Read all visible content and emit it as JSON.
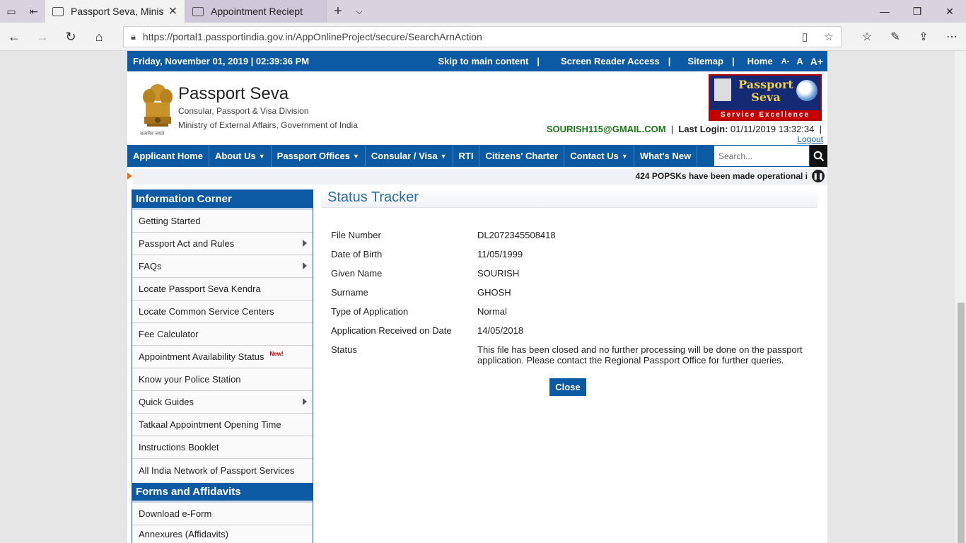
{
  "browser": {
    "tabs": [
      {
        "title": "Passport Seva, Ministry",
        "active": true
      },
      {
        "title": "Appointment Reciept",
        "active": false
      }
    ],
    "url": "https://portal1.passportindia.gov.in/AppOnlineProject/secure/SearchArnAction"
  },
  "topbar": {
    "datetime": "Friday,  November  01, 2019 | 02:39:36 PM",
    "skip": "Skip to main content",
    "screen_reader": "Screen Reader Access",
    "sitemap": "Sitemap",
    "home": "Home",
    "font_small": "A-",
    "font_normal": "A",
    "font_large": "A+",
    "sep": "|"
  },
  "header": {
    "title": "Passport Seva",
    "subtitle1": "Consular, Passport & Visa Division",
    "subtitle2": "Ministry of External Affairs, Government of India",
    "emblem_caption": "सत्यमेव जयते",
    "logo_line1": "Passport",
    "logo_line2": "Seva",
    "logo_band": "Service Excellence",
    "user_email": "SOURISH115@GMAIL.COM",
    "last_login_label": "Last Login:",
    "last_login_value": "01/11/2019 13:32:34",
    "logout": "Logout"
  },
  "nav": {
    "items": [
      {
        "label": "Applicant Home"
      },
      {
        "label": "About Us"
      },
      {
        "label": "Passport Offices"
      },
      {
        "label": "Consular / Visa"
      },
      {
        "label": "RTI"
      },
      {
        "label": "Citizens' Charter"
      },
      {
        "label": "Contact Us"
      },
      {
        "label": "What's New"
      }
    ],
    "search_placeholder": "Search..."
  },
  "ticker": {
    "text": "424 POPSKs have been made operational i"
  },
  "sidebar": {
    "section1_title": "Information Corner",
    "items": [
      {
        "label": "Getting Started"
      },
      {
        "label": "Passport Act and Rules"
      },
      {
        "label": "FAQs"
      },
      {
        "label": "Locate Passport Seva Kendra"
      },
      {
        "label": "Locate Common Service Centers"
      },
      {
        "label": "Fee Calculator"
      },
      {
        "label": "Appointment Availability Status"
      },
      {
        "label": "Know your Police Station"
      },
      {
        "label": "Quick Guides"
      },
      {
        "label": "Tatkaal Appointment Opening Time"
      },
      {
        "label": "Instructions Booklet"
      },
      {
        "label": "All India Network of Passport Services"
      }
    ],
    "new_badge": "New!",
    "section2_title": "Forms and Affidavits",
    "items2": [
      {
        "label": "Download e-Form"
      },
      {
        "label": "Annexures (Affidavits)"
      }
    ]
  },
  "status": {
    "title": "Status Tracker",
    "rows": [
      {
        "label": "File Number",
        "value": "DL2072345508418"
      },
      {
        "label": "Date of Birth",
        "value": "11/05/1999"
      },
      {
        "label": "Given Name",
        "value": "SOURISH"
      },
      {
        "label": "Surname",
        "value": "GHOSH"
      },
      {
        "label": "Type of Application",
        "value": "Normal"
      },
      {
        "label": "Application Received on Date",
        "value": "14/05/2018"
      },
      {
        "label": "Status",
        "value": "This file has been closed and no further processing will be done on the passport application. Please contact the Regional Passport Office for further queries."
      }
    ],
    "close_label": "Close"
  },
  "colors": {
    "primary_blue": "#0b5aa3",
    "email_green": "#177a17",
    "ticker_marker": "#e5731b",
    "new_red": "#d00000"
  }
}
